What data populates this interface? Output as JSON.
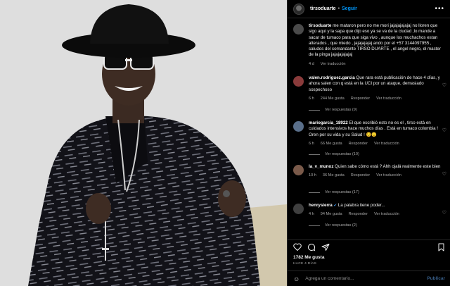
{
  "post": {
    "username": "tirsoduarte",
    "follow_label": "Seguir",
    "caption_user": "tirsoduarte",
    "caption_text": "me mataron pero no me mori jajajajajajaj no lloren que sigo aqui y la sapa que dijo eso ya se va de la ciudad ,lo mande a sacar de tumaco para que siga vivo , aunque los muchachos estan alterados , que miedo , jajajajajaj ando por el +57 3144097955 , saludos del comandante TIRSO DUARTE , el angel negro, el master de la pinga jajajajajajaj",
    "caption_time": "4 d",
    "caption_translate": "Ver traducción"
  },
  "comments": [
    {
      "user": "valen.rodriguez.garcia",
      "text": "Que rara está publicación de hace 4 días, y ahora salen con q está en la UCI por un ataque, demasiado sospechoso",
      "time": "6 h",
      "likes": "244 Me gusta",
      "reply": "Responder",
      "translate": "Ver traducción",
      "replies": "Ver respuestas (9)",
      "avatar_color": "#8a3b3b"
    },
    {
      "user": "mariogarcia_18922",
      "text": "El que escribió esto no es el , tirso está en cuidados intensivos hace muchos días . Está en tumaco colombia ! Oren por su vida y su Salud ! 😔😔",
      "time": "6 h",
      "likes": "66 Me gusta",
      "reply": "Responder",
      "translate": "Ver traducción",
      "replies": "Ver respuestas (10)",
      "avatar_color": "#5a6f8a"
    },
    {
      "user": "la_v_munoz",
      "text": "Quien sabe cómo está ? Ahh ojalá realmente este bien",
      "time": "10 h",
      "likes": "36 Me gusta",
      "reply": "Responder",
      "translate": "Ver traducción",
      "replies": "Ver respuestas (17)",
      "avatar_color": "#7a5a4a"
    },
    {
      "user": "henrysierra",
      "verified": "✔",
      "text": "La palabra tiene poder...",
      "time": "4 h",
      "likes": "94 Me gusta",
      "reply": "Responder",
      "translate": "Ver traducción",
      "replies": "Ver respuestas (2)",
      "avatar_color": "#3f3f3f"
    }
  ],
  "footer": {
    "likes": "1782 Me gusta",
    "ago": "HACE 4 DÍAS",
    "add_comment_placeholder": "Agrega un comentario...",
    "publish_label": "Publicar"
  },
  "icons": {
    "more": "more-options-icon",
    "like": "heart-icon",
    "comment": "comment-icon",
    "share": "share-icon",
    "save": "bookmark-icon",
    "emoji": "emoji-icon"
  },
  "colors": {
    "accent": "#0095f6",
    "verified": "#3897f0",
    "background": "#000000"
  }
}
